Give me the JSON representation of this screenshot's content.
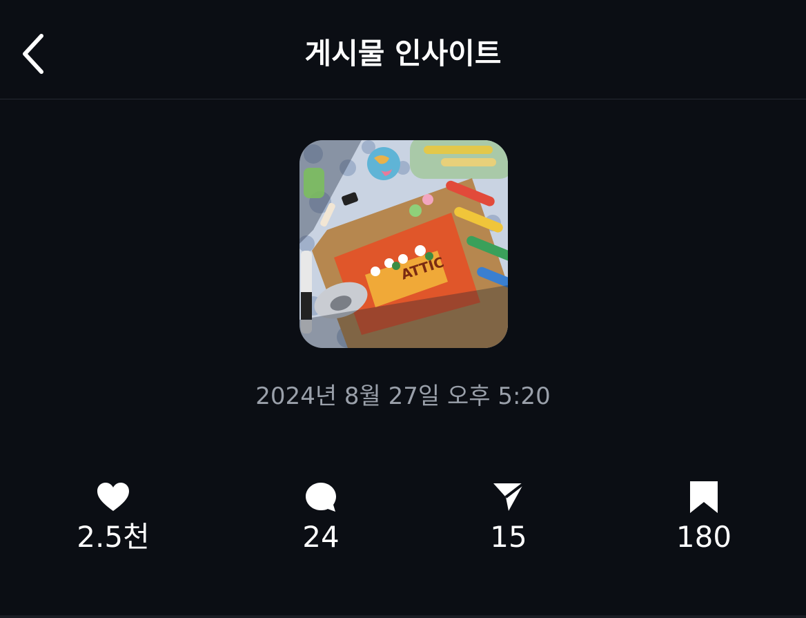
{
  "header": {
    "title": "게시물 인사이트",
    "back_icon": "chevron-left-icon"
  },
  "post": {
    "date": "2024년 8월 27일 오후 5:20"
  },
  "stats": [
    {
      "name": "likes",
      "icon": "heart-icon",
      "value": "2.5천"
    },
    {
      "name": "comments",
      "icon": "comment-bubble-icon",
      "value": "24"
    },
    {
      "name": "shares",
      "icon": "paper-plane-icon",
      "value": "15"
    },
    {
      "name": "saves",
      "icon": "bookmark-icon",
      "value": "180"
    }
  ],
  "colors": {
    "background": "#0b0e14",
    "text": "#ffffff",
    "secondary_text": "#9aa0aa",
    "divider": "#262a33"
  }
}
